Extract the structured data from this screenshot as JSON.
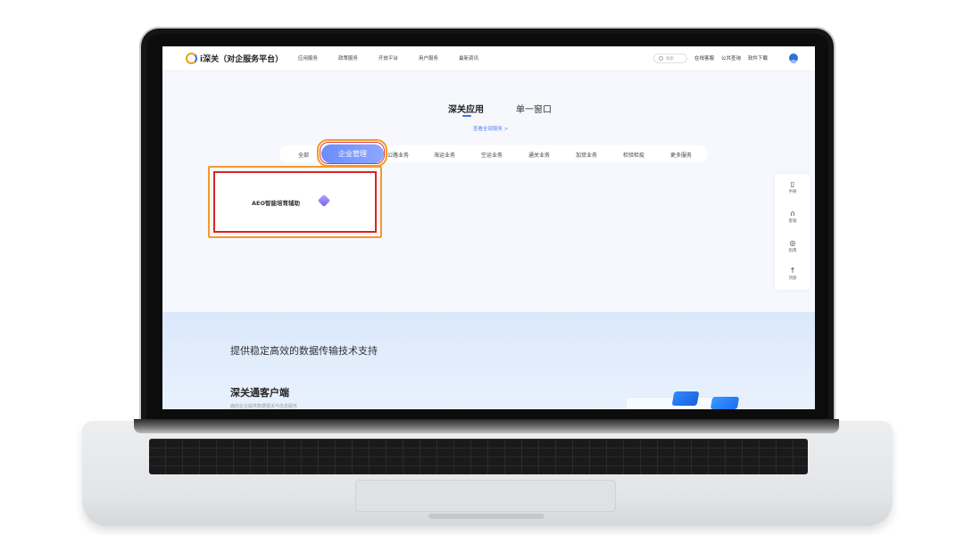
{
  "header": {
    "logo_text": "i深关（对企服务平台）",
    "nav": [
      "应用服务",
      "政策服务",
      "开放平台",
      "用户服务",
      "最新资讯"
    ],
    "search_placeholder": "搜索",
    "right_links": [
      "在线客服",
      "公共查询",
      "软件下载"
    ]
  },
  "main": {
    "tabs": [
      "深关应用",
      "单一窗口"
    ],
    "view_all": "查看全部服务 >",
    "categories": [
      "全部",
      "企业管理",
      "公路业务",
      "海运业务",
      "空运业务",
      "通关业务",
      "加贸业务",
      "检验检疫",
      "更多服务"
    ],
    "active_category": "企业管理",
    "card": {
      "title": "AEO智能培育辅助",
      "icon": "layers-icon"
    }
  },
  "side_tools": [
    {
      "label": "手册",
      "icon": "bookmark-icon"
    },
    {
      "label": "客服",
      "icon": "headset-icon"
    },
    {
      "label": "指南",
      "icon": "compass-icon"
    },
    {
      "label": "顶部",
      "icon": "arrow-up-icon"
    }
  ],
  "bottom": {
    "slogan": "提供稳定高效的数据传输技术支持",
    "client_title": "深关通客户端",
    "client_sub": "面向企业提供数据报关与信息服务"
  },
  "colors": {
    "accent": "#6b8dfb",
    "highlight_orange": "#f39a2b",
    "highlight_red": "#e02020",
    "logo_orange": "#e8a21a"
  }
}
